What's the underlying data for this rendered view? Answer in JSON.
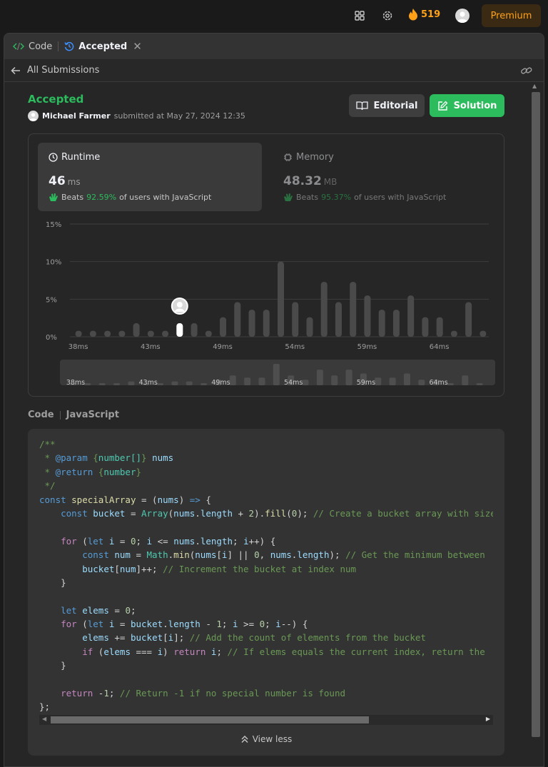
{
  "topbar": {
    "streak_count": "519",
    "premium_label": "Premium"
  },
  "tabs": {
    "code_label": "Code",
    "accepted_label": "Accepted"
  },
  "subbar": {
    "back_label": "All Submissions"
  },
  "submission": {
    "status": "Accepted",
    "user": "Michael Farmer",
    "submitted_text": "submitted at May 27, 2024 12:35",
    "editorial_label": "Editorial",
    "solution_label": "Solution"
  },
  "runtime": {
    "title": "Runtime",
    "value": "46",
    "unit": "ms",
    "beats_label": "Beats",
    "beats_pct": "92.59%",
    "beats_suffix": "of users with JavaScript"
  },
  "memory": {
    "title": "Memory",
    "value": "48.32",
    "unit": "MB",
    "beats_label": "Beats",
    "beats_pct": "95.37%",
    "beats_suffix": "of users with JavaScript"
  },
  "chart_data": {
    "type": "bar",
    "y_ticks": [
      "15%",
      "10%",
      "5%",
      "0%"
    ],
    "ylim": [
      0,
      15
    ],
    "x_tick_labels": [
      "38ms",
      "43ms",
      "49ms",
      "54ms",
      "59ms",
      "64ms"
    ],
    "values": [
      0.8,
      0.8,
      0.8,
      0.8,
      1.8,
      0.8,
      0.8,
      1.8,
      1.8,
      0.8,
      2.6,
      4.6,
      3.6,
      3.6,
      10,
      4.6,
      2.6,
      7.3,
      4.6,
      7.3,
      5.5,
      3.6,
      3.6,
      5.5,
      2.6,
      2.6,
      0.8,
      4.6,
      0.8
    ],
    "highlight_index": 7,
    "series_color": "#4a4a4a",
    "highlight_color": "#ffffff"
  },
  "code_section": {
    "label": "Code",
    "language": "JavaScript",
    "view_less_label": "View less"
  },
  "code_lines": [
    [
      [
        "/**",
        "c-com"
      ]
    ],
    [
      [
        " * ",
        "c-com"
      ],
      [
        "@param",
        "c-kw"
      ],
      [
        " {",
        "c-com"
      ],
      [
        "number[]",
        "c-type"
      ],
      [
        "} ",
        "c-com"
      ],
      [
        "nums",
        "c-var"
      ]
    ],
    [
      [
        " * ",
        "c-com"
      ],
      [
        "@return",
        "c-kw"
      ],
      [
        " {",
        "c-com"
      ],
      [
        "number",
        "c-type"
      ],
      [
        "}",
        "c-com"
      ]
    ],
    [
      [
        " */",
        "c-com"
      ]
    ],
    [
      [
        "const ",
        "c-kw"
      ],
      [
        "specialArray",
        "c-fn"
      ],
      [
        " = (",
        ""
      ],
      [
        "nums",
        "c-var"
      ],
      [
        ") ",
        ""
      ],
      [
        "=>",
        "c-kw"
      ],
      [
        " {",
        ""
      ]
    ],
    [
      [
        "    ",
        ""
      ],
      [
        "const ",
        "c-kw"
      ],
      [
        "bucket",
        "c-var"
      ],
      [
        " = ",
        ""
      ],
      [
        "Array",
        "c-type"
      ],
      [
        "(",
        ""
      ],
      [
        "nums",
        "c-var"
      ],
      [
        ".",
        ""
      ],
      [
        "length",
        "c-var"
      ],
      [
        " + ",
        ""
      ],
      [
        "2",
        "c-num"
      ],
      [
        ").",
        ""
      ],
      [
        "fill",
        "c-fn"
      ],
      [
        "(",
        ""
      ],
      [
        "0",
        "c-num"
      ],
      [
        "); ",
        ""
      ],
      [
        "// Create a bucket array with size",
        "c-com"
      ]
    ],
    [
      [
        "",
        ""
      ]
    ],
    [
      [
        "    ",
        ""
      ],
      [
        "for",
        "c-ctl"
      ],
      [
        " (",
        ""
      ],
      [
        "let ",
        "c-kw"
      ],
      [
        "i",
        "c-var"
      ],
      [
        " = ",
        ""
      ],
      [
        "0",
        "c-num"
      ],
      [
        "; ",
        ""
      ],
      [
        "i",
        "c-var"
      ],
      [
        " <= ",
        ""
      ],
      [
        "nums",
        "c-var"
      ],
      [
        ".",
        ""
      ],
      [
        "length",
        "c-var"
      ],
      [
        "; ",
        ""
      ],
      [
        "i",
        "c-var"
      ],
      [
        "++) {",
        ""
      ]
    ],
    [
      [
        "        ",
        ""
      ],
      [
        "const ",
        "c-kw"
      ],
      [
        "num",
        "c-var"
      ],
      [
        " = ",
        ""
      ],
      [
        "Math",
        "c-type"
      ],
      [
        ".",
        ""
      ],
      [
        "min",
        "c-fn"
      ],
      [
        "(",
        ""
      ],
      [
        "nums",
        "c-var"
      ],
      [
        "[",
        ""
      ],
      [
        "i",
        "c-var"
      ],
      [
        "] || ",
        ""
      ],
      [
        "0",
        "c-num"
      ],
      [
        ", ",
        ""
      ],
      [
        "nums",
        "c-var"
      ],
      [
        ".",
        ""
      ],
      [
        "length",
        "c-var"
      ],
      [
        "); ",
        ""
      ],
      [
        "// Get the minimum between",
        "c-com"
      ]
    ],
    [
      [
        "        ",
        ""
      ],
      [
        "bucket",
        "c-var"
      ],
      [
        "[",
        ""
      ],
      [
        "num",
        "c-var"
      ],
      [
        "]++; ",
        ""
      ],
      [
        "// Increment the bucket at index num",
        "c-com"
      ]
    ],
    [
      [
        "    }",
        ""
      ]
    ],
    [
      [
        "",
        ""
      ]
    ],
    [
      [
        "    ",
        ""
      ],
      [
        "let ",
        "c-kw"
      ],
      [
        "elems",
        "c-var"
      ],
      [
        " = ",
        ""
      ],
      [
        "0",
        "c-num"
      ],
      [
        ";",
        ""
      ]
    ],
    [
      [
        "    ",
        ""
      ],
      [
        "for",
        "c-ctl"
      ],
      [
        " (",
        ""
      ],
      [
        "let ",
        "c-kw"
      ],
      [
        "i",
        "c-var"
      ],
      [
        " = ",
        ""
      ],
      [
        "bucket",
        "c-var"
      ],
      [
        ".",
        ""
      ],
      [
        "length",
        "c-var"
      ],
      [
        " - ",
        ""
      ],
      [
        "1",
        "c-num"
      ],
      [
        "; ",
        ""
      ],
      [
        "i",
        "c-var"
      ],
      [
        " >= ",
        ""
      ],
      [
        "0",
        "c-num"
      ],
      [
        "; ",
        ""
      ],
      [
        "i",
        "c-var"
      ],
      [
        "--) {",
        ""
      ]
    ],
    [
      [
        "        ",
        ""
      ],
      [
        "elems",
        "c-var"
      ],
      [
        " += ",
        ""
      ],
      [
        "bucket",
        "c-var"
      ],
      [
        "[",
        ""
      ],
      [
        "i",
        "c-var"
      ],
      [
        "]; ",
        ""
      ],
      [
        "// Add the count of elements from the bucket",
        "c-com"
      ]
    ],
    [
      [
        "        ",
        ""
      ],
      [
        "if",
        "c-ctl"
      ],
      [
        " (",
        ""
      ],
      [
        "elems",
        "c-var"
      ],
      [
        " === ",
        ""
      ],
      [
        "i",
        "c-var"
      ],
      [
        ") ",
        ""
      ],
      [
        "return ",
        "c-ctl"
      ],
      [
        "i",
        "c-var"
      ],
      [
        "; ",
        ""
      ],
      [
        "// If elems equals the current index, return the",
        "c-com"
      ]
    ],
    [
      [
        "    }",
        ""
      ]
    ],
    [
      [
        "",
        ""
      ]
    ],
    [
      [
        "    ",
        ""
      ],
      [
        "return ",
        "c-ctl"
      ],
      [
        "-",
        ""
      ],
      [
        "1",
        "c-num"
      ],
      [
        "; ",
        ""
      ],
      [
        "// Return -1 if no special number is found",
        "c-com"
      ]
    ],
    [
      [
        "};",
        ""
      ]
    ]
  ]
}
